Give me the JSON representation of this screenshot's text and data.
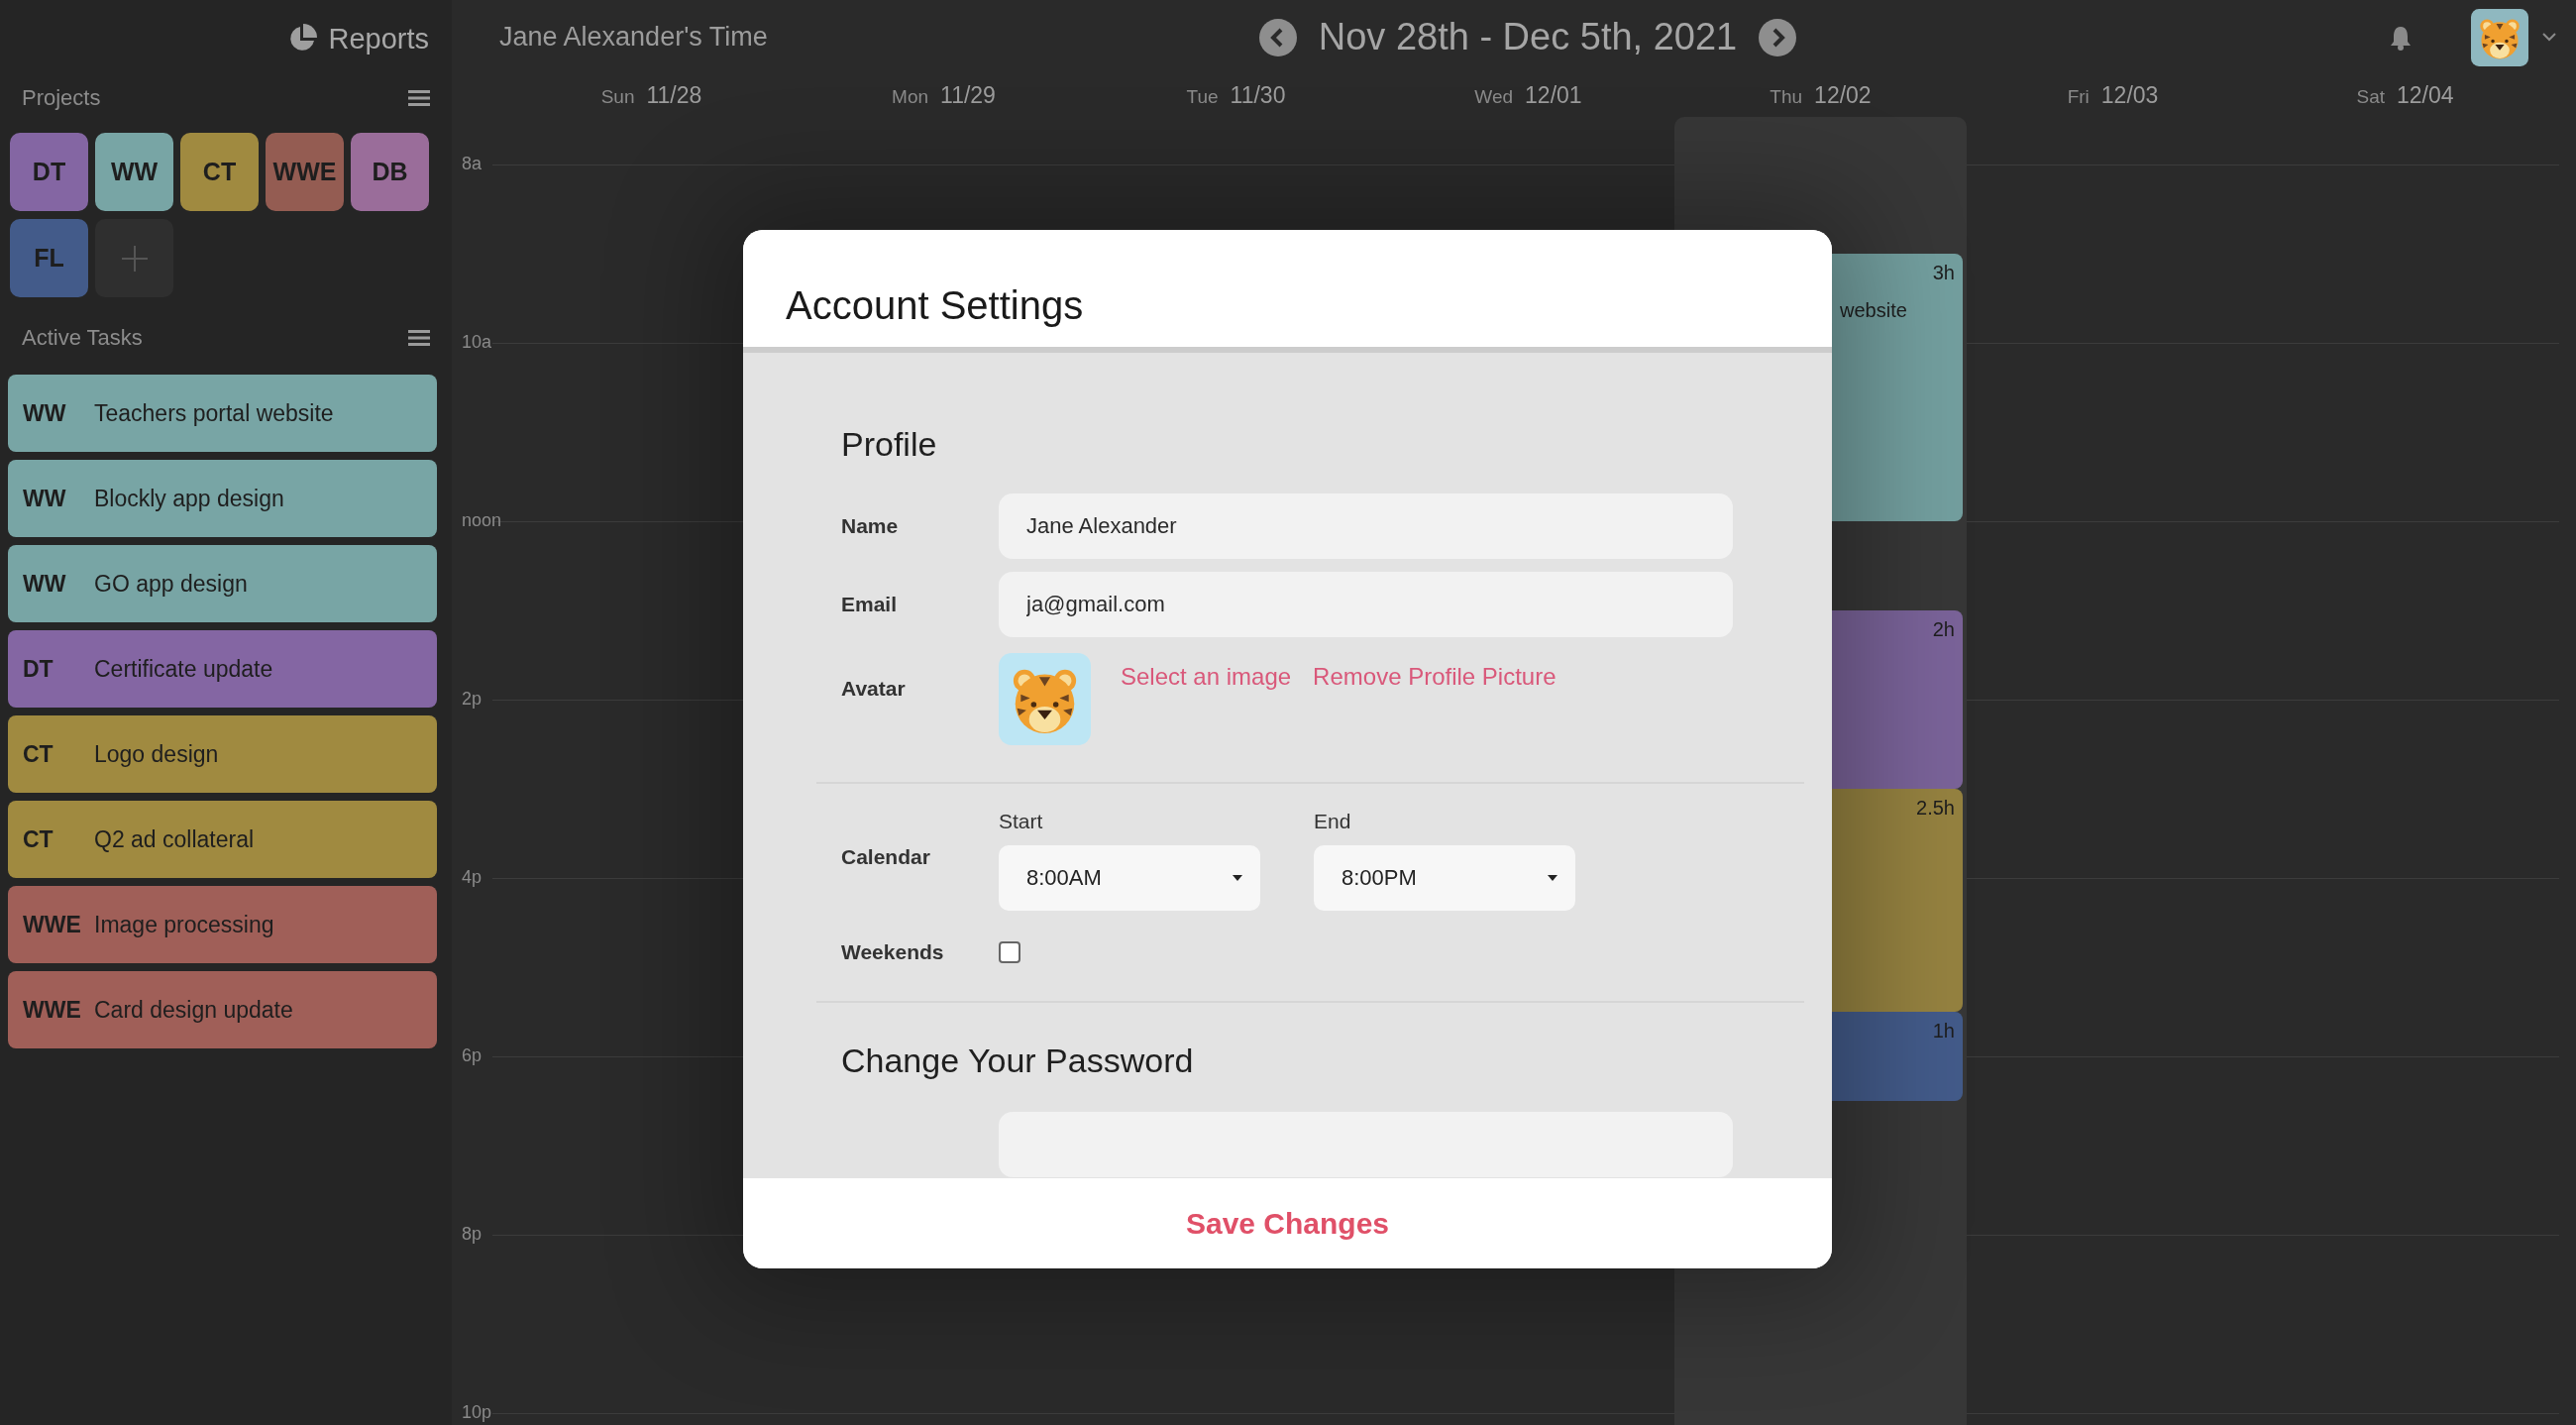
{
  "sidebar": {
    "reports": "Reports",
    "projects_title": "Projects",
    "projects": [
      {
        "code": "DT",
        "color": "#8466a3"
      },
      {
        "code": "WW",
        "color": "#78a5a5"
      },
      {
        "code": "CT",
        "color": "#a08a40"
      },
      {
        "code": "WWE",
        "color": "#945c52"
      },
      {
        "code": "DB",
        "color": "#9a6d9a"
      },
      {
        "code": "FL",
        "color": "#435b8a"
      }
    ],
    "active_tasks_title": "Active Tasks",
    "tasks": [
      {
        "code": "WW",
        "name": "Teachers portal website",
        "color": "#78a5a5"
      },
      {
        "code": "WW",
        "name": "Blockly app design",
        "color": "#78a5a5"
      },
      {
        "code": "WW",
        "name": "GO app design",
        "color": "#78a5a5"
      },
      {
        "code": "DT",
        "name": "Certificate update",
        "color": "#8466a3"
      },
      {
        "code": "CT",
        "name": "Logo design",
        "color": "#a08a40"
      },
      {
        "code": "CT",
        "name": "Q2 ad collateral",
        "color": "#a08a40"
      },
      {
        "code": "WWE",
        "name": "Image processing",
        "color": "#a05f58"
      },
      {
        "code": "WWE",
        "name": "Card design update",
        "color": "#a05f58"
      }
    ]
  },
  "header": {
    "title": "Jane Alexander's Time",
    "range": "Nov 28th - Dec 5th, 2021"
  },
  "days": [
    {
      "weekday": "Sun",
      "date": "11/28",
      "today": false
    },
    {
      "weekday": "Mon",
      "date": "11/29",
      "today": false
    },
    {
      "weekday": "Tue",
      "date": "11/30",
      "today": false
    },
    {
      "weekday": "Wed",
      "date": "12/01",
      "today": false
    },
    {
      "weekday": "Thu",
      "date": "12/02",
      "today": true
    },
    {
      "weekday": "Fri",
      "date": "12/03",
      "today": false
    },
    {
      "weekday": "Sat",
      "date": "12/04",
      "today": false
    }
  ],
  "times": [
    "8a",
    "10a",
    "noon",
    "2p",
    "4p",
    "6p",
    "8p",
    "10p"
  ],
  "events": [
    {
      "title": "website",
      "duration": "3h",
      "color": "#739f9f"
    },
    {
      "duration": "2h",
      "color": "#7a6399"
    },
    {
      "duration": "2.5h",
      "color": "#958240"
    },
    {
      "duration": "1h",
      "color": "#435b8a"
    }
  ],
  "modal": {
    "title": "Account Settings",
    "profile_heading": "Profile",
    "name_label": "Name",
    "name_value": "Jane Alexander",
    "email_label": "Email",
    "email_value": "ja@gmail.com",
    "avatar_label": "Avatar",
    "select_image": "Select an image",
    "remove_picture": "Remove Profile Picture",
    "calendar_label": "Calendar",
    "start_label": "Start",
    "start_value": "8:00AM",
    "end_label": "End",
    "end_value": "8:00PM",
    "weekends_label": "Weekends",
    "weekends_checked": false,
    "password_heading": "Change Your Password",
    "save": "Save Changes"
  }
}
